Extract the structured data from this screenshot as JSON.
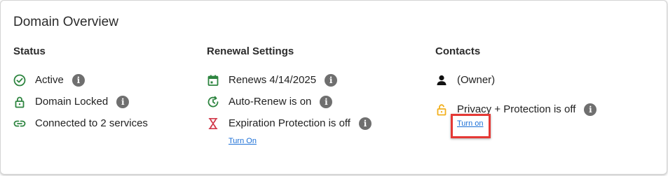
{
  "overview": {
    "title": "Domain Overview"
  },
  "status": {
    "heading": "Status",
    "items": [
      {
        "label": "Active",
        "icon": "check-circle-icon"
      },
      {
        "label": "Domain Locked",
        "icon": "lock-icon"
      },
      {
        "label": "Connected to 2 services",
        "icon": "link-icon"
      }
    ]
  },
  "renewal": {
    "heading": "Renewal Settings",
    "renews": "Renews 4/14/2025",
    "auto_renew": "Auto-Renew is on",
    "expiration": "Expiration Protection is off",
    "expiration_link": "Turn On"
  },
  "contacts": {
    "heading": "Contacts",
    "owner": "(Owner)",
    "privacy": "Privacy + Protection is off",
    "privacy_link": "Turn on"
  },
  "colors": {
    "green": "#2e8540",
    "red": "#d1394b",
    "gold": "#f2b01e",
    "link": "#1b6fd6",
    "highlight": "#e53935"
  }
}
